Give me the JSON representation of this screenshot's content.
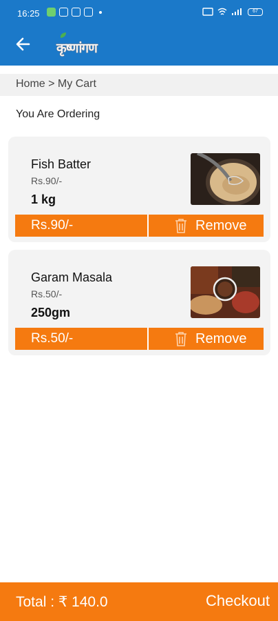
{
  "status_bar": {
    "time": "16:25",
    "battery": "67"
  },
  "app_bar": {
    "logo_text": "कृष्णांगण"
  },
  "breadcrumb": {
    "text": "Home > My Cart"
  },
  "heading": "You Are Ordering",
  "cart_items": [
    {
      "name": "Fish Batter",
      "unit_price": "Rs.90/-",
      "quantity": "1 kg",
      "amount": "Rs.90/-",
      "remove_label": "Remove",
      "image": "fish-batter-photo"
    },
    {
      "name": "Garam Masala",
      "unit_price": "Rs.50/-",
      "quantity": "250gm",
      "amount": "Rs.50/-",
      "remove_label": "Remove",
      "image": "garam-masala-photo"
    }
  ],
  "footer": {
    "total_label": "Total : ₹ 140.0",
    "checkout_label": "Checkout"
  },
  "colors": {
    "primary": "#1b79c9",
    "accent": "#f57a10",
    "card_bg": "#f3f3f3"
  },
  "icons": [
    "back-arrow-icon",
    "trash-icon"
  ]
}
